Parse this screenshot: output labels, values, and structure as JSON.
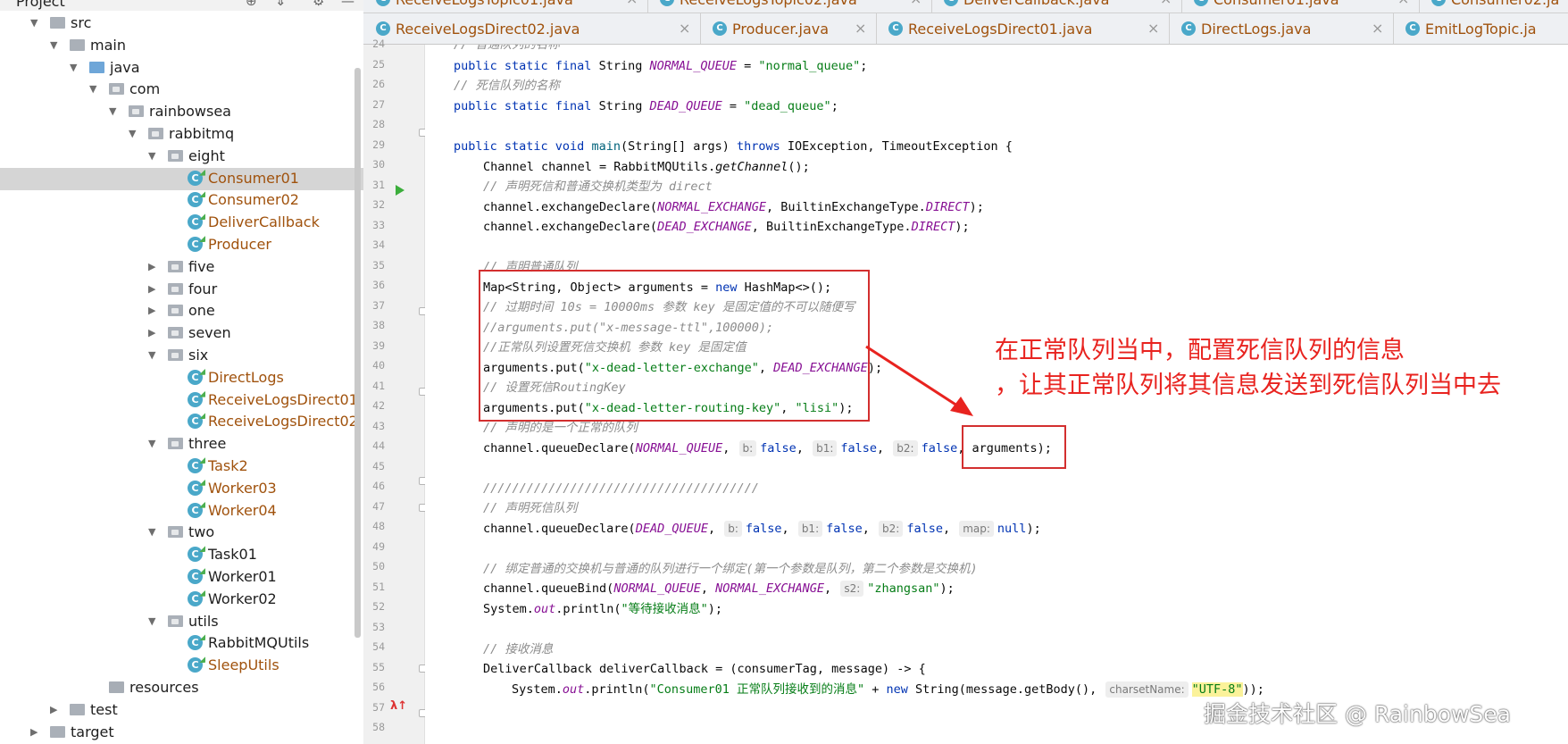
{
  "project_header": {
    "title": "Project"
  },
  "tree": [
    {
      "label": "src",
      "kind": "dir",
      "expanded": true
    },
    {
      "label": "main",
      "kind": "dir",
      "expanded": true
    },
    {
      "label": "java",
      "kind": "dir",
      "expanded": true
    },
    {
      "label": "com",
      "kind": "pkg",
      "expanded": true
    },
    {
      "label": "rainbowsea",
      "kind": "pkg",
      "expanded": true
    },
    {
      "label": "rabbitmq",
      "kind": "pkg",
      "expanded": true
    },
    {
      "label": "eight",
      "kind": "pkg",
      "expanded": true
    },
    {
      "label": "Consumer01",
      "kind": "class",
      "selected": true
    },
    {
      "label": "Consumer02",
      "kind": "class"
    },
    {
      "label": "DeliverCallback",
      "kind": "class"
    },
    {
      "label": "Producer",
      "kind": "class"
    },
    {
      "label": "five",
      "kind": "pkg",
      "expanded": false
    },
    {
      "label": "four",
      "kind": "pkg",
      "expanded": false
    },
    {
      "label": "one",
      "kind": "pkg",
      "expanded": false
    },
    {
      "label": "seven",
      "kind": "pkg",
      "expanded": false
    },
    {
      "label": "six",
      "kind": "pkg",
      "expanded": true
    },
    {
      "label": "DirectLogs",
      "kind": "class"
    },
    {
      "label": "ReceiveLogsDirect01",
      "kind": "class"
    },
    {
      "label": "ReceiveLogsDirect02",
      "kind": "class"
    },
    {
      "label": "three",
      "kind": "pkg",
      "expanded": true
    },
    {
      "label": "Task2",
      "kind": "class"
    },
    {
      "label": "Worker03",
      "kind": "class"
    },
    {
      "label": "Worker04",
      "kind": "class"
    },
    {
      "label": "two",
      "kind": "pkg",
      "expanded": true
    },
    {
      "label": "Task01",
      "kind": "class",
      "plain": true
    },
    {
      "label": "Worker01",
      "kind": "class",
      "plain": true
    },
    {
      "label": "Worker02",
      "kind": "class",
      "plain": true
    },
    {
      "label": "utils",
      "kind": "pkg",
      "expanded": true
    },
    {
      "label": "RabbitMQUtils",
      "kind": "class",
      "plain": true
    },
    {
      "label": "SleepUtils",
      "kind": "class"
    },
    {
      "label": "resources",
      "kind": "res"
    },
    {
      "label": "test",
      "kind": "dir",
      "expanded": false
    },
    {
      "label": "target",
      "kind": "dir",
      "expanded": false
    }
  ],
  "tabs_row1": [
    "ReceiveLogsTopic01.java",
    "ReceiveLogsTopic02.java",
    "DeliverCallback.java",
    "Consumer01.java",
    "Consumer02.ja"
  ],
  "tabs_row2": [
    "ReceiveLogsDirect02.java",
    "Producer.java",
    "ReceiveLogsDirect01.java",
    "DirectLogs.java",
    "EmitLogTopic.ja"
  ],
  "line_numbers": [
    "24",
    "25",
    "26",
    "27",
    "28",
    "29",
    "30",
    "31",
    "32",
    "33",
    "34",
    "35",
    "36",
    "37",
    "38",
    "39",
    "40",
    "41",
    "42",
    "43",
    "44",
    "45",
    "46",
    "47",
    "48",
    "49",
    "50",
    "51",
    "52",
    "53",
    "54",
    "55",
    "56",
    "57",
    "58"
  ],
  "annotation": {
    "line1": "在正常队列当中，配置死信队列的信息",
    "line2": "，让其正常队列将其信息发送到死信队列当中去"
  },
  "watermark": "掘金技术社区 @ RainbowSea",
  "colors": {
    "annotation_red": "#e8231f",
    "box_red": "#d32f2f",
    "keyword": "#0033b3",
    "string": "#067d17",
    "comment": "#8c8c8c",
    "constant": "#871094"
  }
}
